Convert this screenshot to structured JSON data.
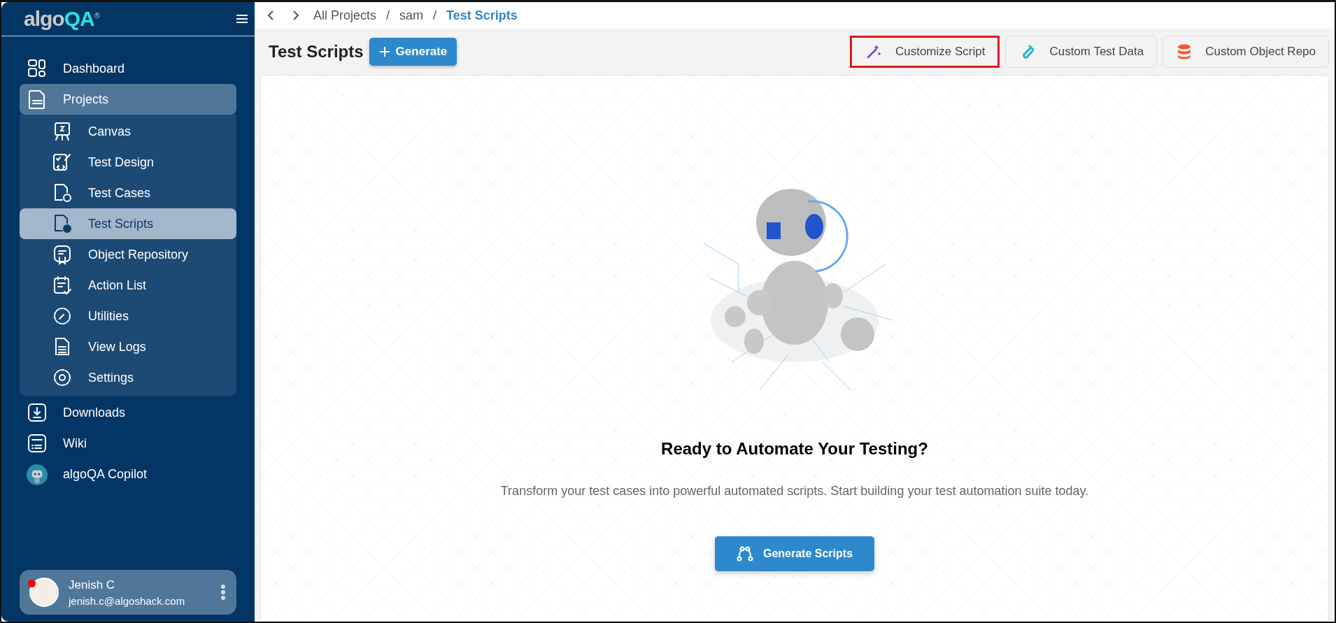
{
  "sidebar": {
    "logo": {
      "brand": "algo",
      "accent": "QA",
      "mark": "®"
    },
    "items": [
      {
        "label": "Dashboard",
        "selected": false
      },
      {
        "label": "Projects",
        "selected": true,
        "expanded": true,
        "children": [
          {
            "label": "Canvas",
            "selected": false
          },
          {
            "label": "Test Design",
            "selected": false
          },
          {
            "label": "Test Cases",
            "selected": false
          },
          {
            "label": "Test Scripts",
            "selected": true
          },
          {
            "label": "Object Repository",
            "selected": false
          },
          {
            "label": "Action List",
            "selected": false
          },
          {
            "label": "Utilities",
            "selected": false
          },
          {
            "label": "View Logs",
            "selected": false
          },
          {
            "label": "Settings",
            "selected": false
          }
        ]
      },
      {
        "label": "Downloads",
        "selected": false
      },
      {
        "label": "Wiki",
        "selected": false
      },
      {
        "label": "algoQA Copilot",
        "selected": false
      }
    ],
    "user": {
      "name": "Jenish C",
      "email": "jenish.c@algoshack.com",
      "notification": true
    }
  },
  "breadcrumb": {
    "separator": "/",
    "items": [
      "All Projects",
      "sam",
      "Test Scripts"
    ]
  },
  "header": {
    "title": "Test Scripts",
    "generate_button": "Generate",
    "actions": [
      {
        "label": "Customize Script",
        "highlighted": true,
        "color": "#7b3fd0"
      },
      {
        "label": "Custom Test Data",
        "highlighted": false,
        "color": "#1fb8cf"
      },
      {
        "label": "Custom Object Repo",
        "highlighted": false,
        "color": "#f05a28"
      }
    ]
  },
  "empty_state": {
    "title": "Ready to Automate Your Testing?",
    "text": "Transform your test cases into powerful automated scripts. Start building your test automation suite today.",
    "button": "Generate Scripts"
  }
}
